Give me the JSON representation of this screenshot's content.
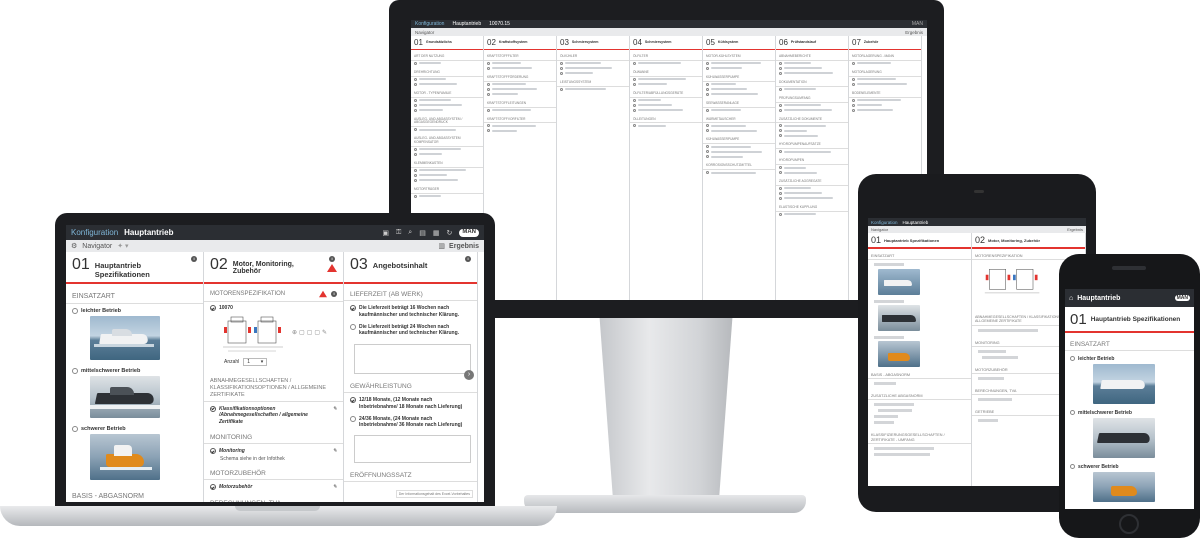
{
  "app": {
    "konfiguration_tab": "Konfiguration",
    "main_tab": "Hauptantrieb",
    "navigator": "Navigator",
    "ergebnis": "Ergebnis",
    "logo": "MAN"
  },
  "laptop": {
    "columns": [
      {
        "num": "01",
        "title": "Hauptantrieb Spezifikationen",
        "sections": [
          {
            "label": "EINSATZART",
            "items": [
              "leichter Betrieb",
              "mittelschwerer Betrieb",
              "schwerer Betrieb"
            ]
          },
          {
            "label": "BASIS - ABGASNORM",
            "items": []
          }
        ]
      },
      {
        "num": "02",
        "title": "Motor, Monitoring, Zubehör",
        "motor_section": "MOTORENSPEZIFIKATION",
        "motor_id": "10070",
        "anzahl_label": "Anzahl",
        "anzahl_value": "1",
        "sections": [
          {
            "label": "ABNAHMEGESELLSCHAFTEN / KLASSIFIKATIONSOPTIONEN / ALLGEMEINE ZERTIFIKATE",
            "items": [
              "Klassifikationsoptionen /Abnahmegesellschaften / allgemeine Zertifikate"
            ],
            "note": ""
          },
          {
            "label": "MONITORING",
            "items": [
              "Monitoring"
            ],
            "note": "Schema siehe in der Infothek"
          },
          {
            "label": "MOTORZUBEHÖR",
            "items": [
              "Motorzubehör"
            ],
            "note": ""
          },
          {
            "label": "BERECHNUNGEN, TVA",
            "items": [],
            "note": ""
          }
        ]
      },
      {
        "num": "03",
        "title": "Angebotsinhalt",
        "sections": [
          {
            "label": "LIEFERZEIT (AB WERK)",
            "items": [
              "Die Lieferzeit beträgt 16 Wochen nach kaufmännischer und technischer Klärung.",
              "Die Lieferzeit beträgt 24 Wochen nach kaufmännischer und technischer Klärung."
            ]
          },
          {
            "label": "GEWÄHRLEISTUNG",
            "items": [
              "12/18 Monate, (12 Monate nach Inbetriebnahme/ 18 Monate nach Lieferung)",
              "24/36 Monate, (24 Monate nach Inbetriebnahme/ 36 Monate nach Lieferung)"
            ]
          },
          {
            "label": "ERÖFFNUNGSSATZ",
            "items": []
          }
        ],
        "footer_note": "Der Informationsgehalt des Excel-Vorbehaltes"
      }
    ]
  },
  "desktop": {
    "title": "10070.15",
    "columns": [
      {
        "num": "01",
        "title": "Grundsätzlichs",
        "sections": [
          "ART DER NUTZUNG",
          "DREHRICHTUNG",
          "MOTOR - TYPENFAMILIE",
          "AUSLEG- UND ABGASSYSTEM / ABGASGEGENDRUCK",
          "AUSLEG- UND ABGASSYSTEM KOMPENSATOR",
          "KLEMMENKASTEN",
          "MOTORTRÄGER"
        ]
      },
      {
        "num": "02",
        "title": "Kraftstoffsystem",
        "sections": [
          "KRAFTSTOFFFILTER",
          "KRAFTSTOFFFÖRDERUNG",
          "KRAFTSTOFFLEITUNGEN",
          "KRAFTSTOFFVORFILTER"
        ]
      },
      {
        "num": "03",
        "title": "Schmiersystem",
        "sections": [
          "ÖLKÜHLER",
          "LEISTUNGSSYSTEM"
        ]
      },
      {
        "num": "04",
        "title": "Schmiersystem",
        "sections": [
          "ÖLFILTER",
          "ÖLWANNE",
          "ÖLFILTER/ABFÜLLUNGSGERÄTE",
          "ÖLLEITUNGEN"
        ]
      },
      {
        "num": "05",
        "title": "Kühlsystem",
        "sections": [
          "MOTOR-KÜHLSYSTEM",
          "KÜHLWASSERPUMPE",
          "SEEWASSERANLAGE",
          "WÄRMETAUSCHER",
          "KÜHLWASSERPUMPE",
          "KORROSIONSSCHUTZMITTEL"
        ]
      },
      {
        "num": "06",
        "title": "Prüfstandslauf",
        "sections": [
          "ABNAHMEBERICHTE",
          "DOKUMENTATION",
          "PRÜFUNGSUMFANG",
          "ZUSÄTZLICHE DOKUMENTE",
          "HYDROPUMPENAUFSÄTZE",
          "HYDROPUMPEN",
          "ZUSÄTZLICHE AGGREGATE",
          "ELASTISCHE KUPPLUNG"
        ]
      },
      {
        "num": "07",
        "title": "Zubehör",
        "sections": [
          "MOTORLAGERUNG - MANN",
          "MOTORLAGERUNG",
          "BODENELEMENTE"
        ]
      }
    ],
    "ergebnis": "Ergebnis"
  },
  "tablet": {
    "columns": [
      {
        "num": "01",
        "title": "Hauptantrieb Spezifikationen",
        "sections": [
          "EINSATZART",
          "BASIS - ABGASNORM",
          "ZUSÄTZLICHE ABGASNORM",
          "KLASSIFIZIERUNGSGESELLSCHAFTEN / ZERTIFIKATE - UMFANG"
        ]
      },
      {
        "num": "02",
        "title": "Motor, Monitoring, Zubehör",
        "sections": [
          "MOTORENSPEZIFIKATION",
          "ABNAHMEGESELLSCHAFTEN / KLASSIFIKATIONSOPTIONEN / ALLGEMEINE ZERTIFIKATE",
          "MONITORING",
          "MOTORZUBEHÖR",
          "BERECHNUNGEN, TVA",
          "GETRIEBE"
        ]
      }
    ]
  },
  "phone": {
    "title": "Hauptantrieb",
    "num": "01",
    "col_title": "Hauptantrieb Spezifikationen",
    "section": "EINSATZART",
    "items": [
      "leichter Betrieb",
      "mittelschwerer Betrieb",
      "schwerer Betrieb"
    ]
  }
}
